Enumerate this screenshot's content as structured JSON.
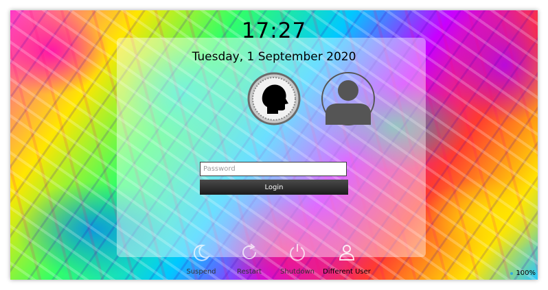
{
  "clock": {
    "time": "17:27",
    "date": "Tuesday, 1 September 2020"
  },
  "users": [
    {
      "label": ""
    },
    {
      "label": ""
    }
  ],
  "password": {
    "placeholder": "Password",
    "value": ""
  },
  "login": {
    "label": "Login"
  },
  "actions": [
    {
      "label": "Suspend",
      "icon": "suspend-icon"
    },
    {
      "label": "Restart",
      "icon": "restart-icon"
    },
    {
      "label": "Shutdown",
      "icon": "shutdown-icon"
    },
    {
      "label": "Different User",
      "icon": "different-user-icon"
    }
  ],
  "battery": {
    "level": "100%"
  }
}
